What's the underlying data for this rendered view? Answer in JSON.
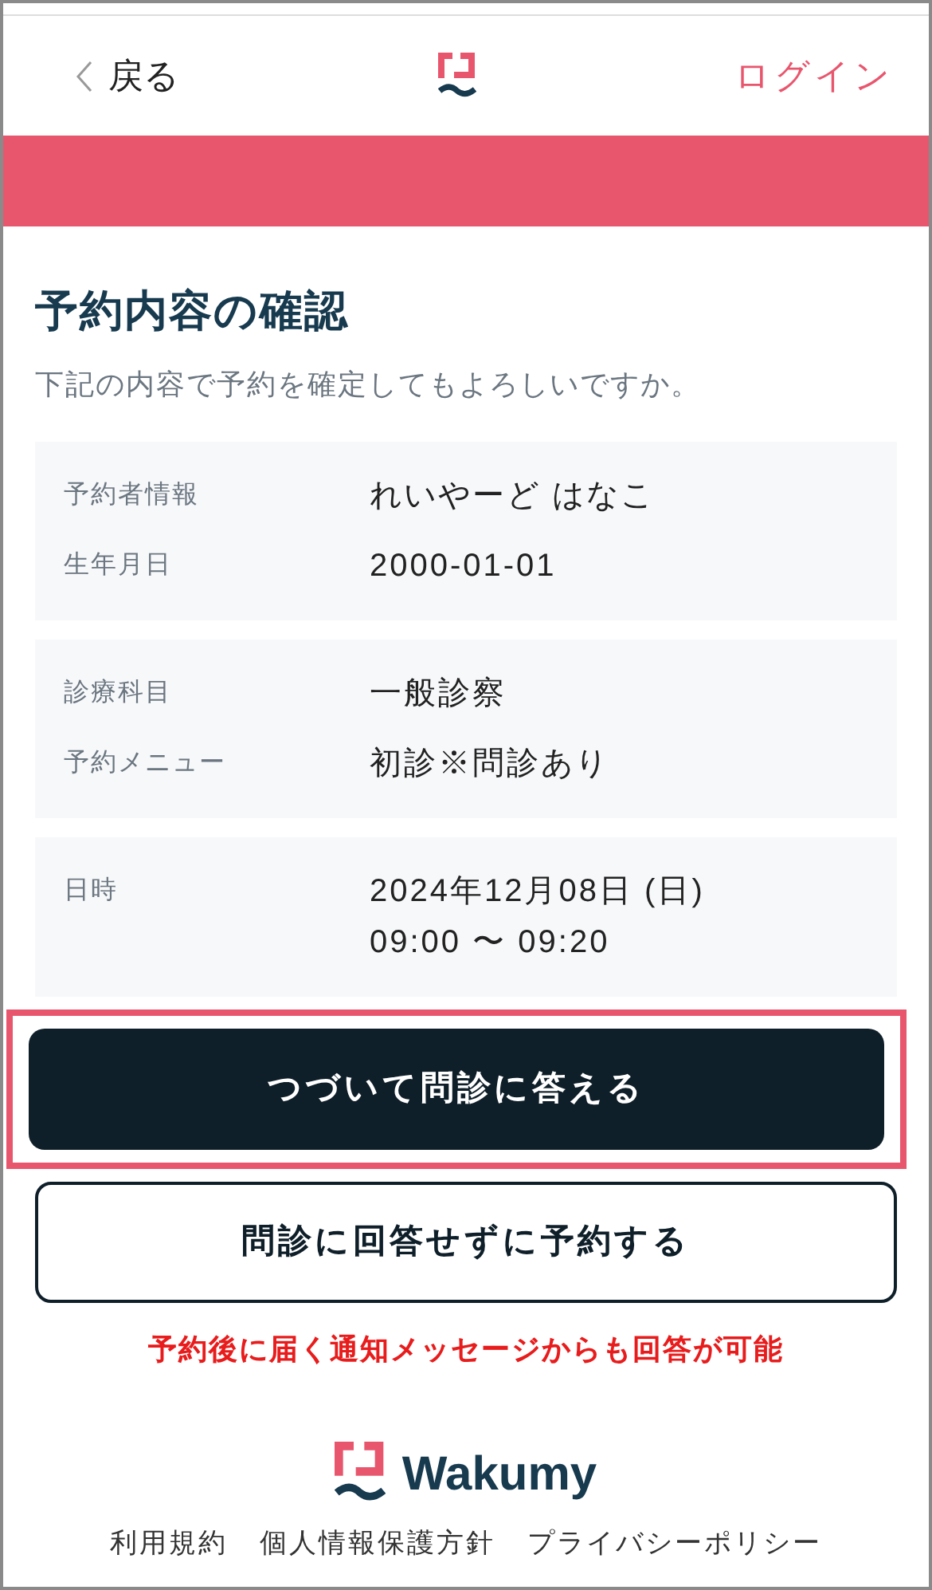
{
  "header": {
    "back": "戻る",
    "login": "ログイン"
  },
  "title": "予約内容の確認",
  "subtitle": "下記の内容で予約を確定してもよろしいですか。",
  "cards": [
    {
      "rows": [
        {
          "label": "予約者情報",
          "lines": [
            "れいやーど はなこ"
          ]
        },
        {
          "label": "生年月日",
          "lines": [
            "2000-01-01"
          ]
        }
      ]
    },
    {
      "rows": [
        {
          "label": "診療科目",
          "lines": [
            "一般診察"
          ]
        },
        {
          "label": "予約メニュー",
          "lines": [
            "初診※問診あり"
          ]
        }
      ]
    },
    {
      "rows": [
        {
          "label": "日時",
          "lines": [
            "2024年12月08日 (日)",
            "09:00 〜 09:20"
          ]
        }
      ]
    }
  ],
  "buttons": [
    {
      "kind": "primary",
      "label": "つづいて問診に答える",
      "highlighted": true
    },
    {
      "kind": "secondary",
      "label": "問診に回答せずに予約する",
      "highlighted": false
    }
  ],
  "note": "予約後に届く通知メッセージからも回答が可能",
  "footer": {
    "brand": "Wakumy",
    "links": [
      "利用規約",
      "個人情報保護方針",
      "プライバシーポリシー"
    ]
  }
}
